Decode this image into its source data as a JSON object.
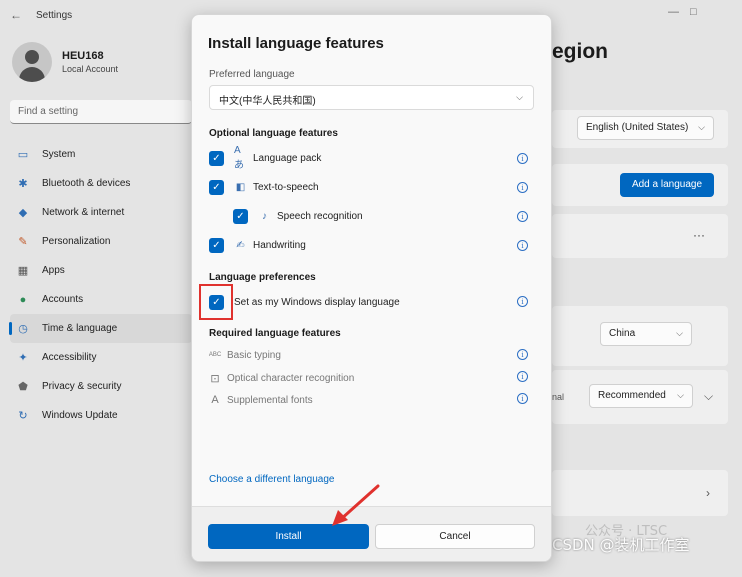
{
  "window": {
    "back_glyph": "←",
    "title": "Settings",
    "controls": [
      "—",
      "□"
    ]
  },
  "user": {
    "name": "HEU168",
    "account_type": "Local Account"
  },
  "search": {
    "placeholder": "Find a setting"
  },
  "sidebar": {
    "items": [
      {
        "label": "System",
        "icon": "monitor-icon",
        "glyph": "▭",
        "color": "#2f6db3"
      },
      {
        "label": "Bluetooth & devices",
        "icon": "bluetooth-icon",
        "glyph": "✱",
        "color": "#2f6db3"
      },
      {
        "label": "Network & internet",
        "icon": "wifi-icon",
        "glyph": "◆",
        "color": "#2f6db3"
      },
      {
        "label": "Personalization",
        "icon": "brush-icon",
        "glyph": "✎",
        "color": "#c0592a"
      },
      {
        "label": "Apps",
        "icon": "apps-icon",
        "glyph": "▦",
        "color": "#555555"
      },
      {
        "label": "Accounts",
        "icon": "person-icon",
        "glyph": "●",
        "color": "#2e8b57"
      },
      {
        "label": "Time & language",
        "icon": "globe-clock-icon",
        "glyph": "◷",
        "color": "#2f6db3",
        "active": true
      },
      {
        "label": "Accessibility",
        "icon": "accessibility-icon",
        "glyph": "✦",
        "color": "#2f6db3"
      },
      {
        "label": "Privacy & security",
        "icon": "shield-icon",
        "glyph": "⬟",
        "color": "#666666"
      },
      {
        "label": "Windows Update",
        "icon": "update-icon",
        "glyph": "↻",
        "color": "#2f6db3"
      }
    ]
  },
  "page": {
    "title_partial": "egion",
    "display_language": "English (United States)",
    "add_language_label": "Add a language",
    "more_glyph": "···",
    "country": "China",
    "format_partial": "nal",
    "format_value": "Recommended"
  },
  "dialog": {
    "title": "Install language features",
    "preferred_label": "Preferred language",
    "preferred_value": "中文(中华人民共和国)",
    "optional_header": "Optional language features",
    "optional_features": [
      {
        "label": "Language pack",
        "icon": "language-pack-icon",
        "glyph": "Á"
      },
      {
        "label": "Text-to-speech",
        "icon": "text-to-speech-icon",
        "glyph": "◧"
      },
      {
        "label": "Speech recognition",
        "icon": "microphone-icon",
        "glyph": "♪"
      },
      {
        "label": "Handwriting",
        "icon": "handwriting-icon",
        "glyph": "✍"
      }
    ],
    "prefs_header": "Language preferences",
    "display_pref_label": "Set as my Windows display language",
    "required_header": "Required language features",
    "required_features": [
      {
        "label": "Basic typing",
        "icon": "keyboard-abc-icon",
        "glyph": "ABC"
      },
      {
        "label": "Optical character recognition",
        "icon": "ocr-icon",
        "glyph": "⊡"
      },
      {
        "label": "Supplemental fonts",
        "icon": "fonts-icon",
        "glyph": "A"
      }
    ],
    "info_glyph": "i",
    "check_glyph": "✓",
    "change_link": "Choose a different language",
    "install_label": "Install",
    "cancel_label": "Cancel"
  },
  "watermark": {
    "line1": "公众号 · LTSC",
    "line2": "CSDN @装机工作室"
  },
  "colors": {
    "accent": "#0067c0",
    "highlight": "#e0322e"
  }
}
